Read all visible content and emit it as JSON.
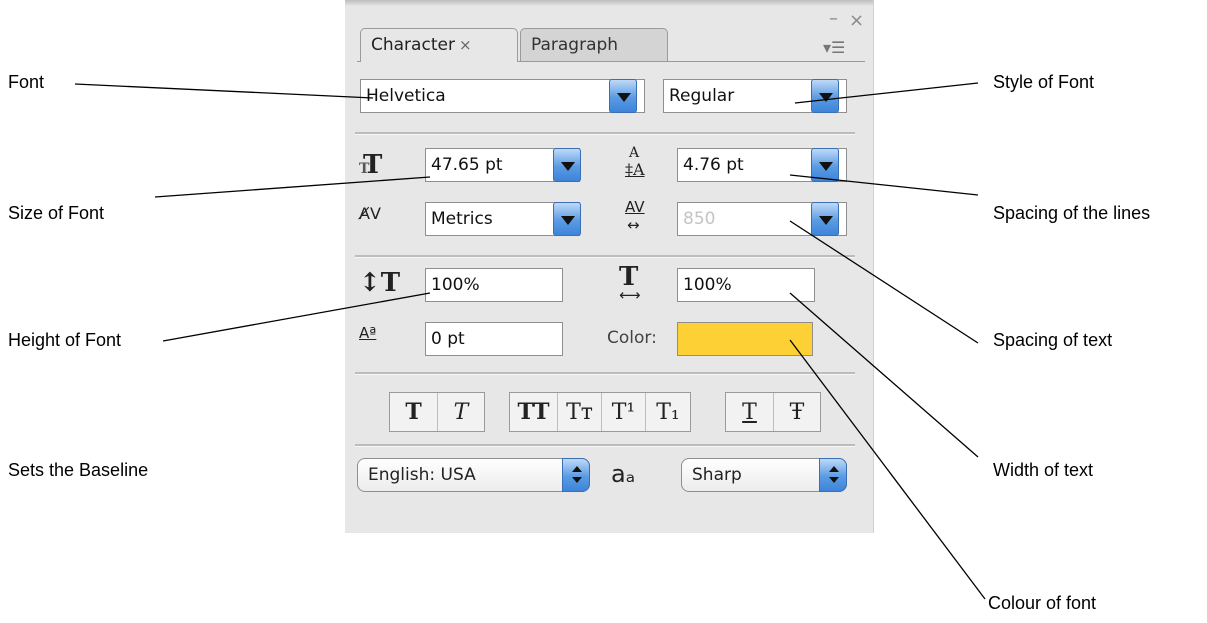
{
  "callouts": {
    "font": "Font",
    "size_of_font": "Size of Font",
    "height_of_font": "Height of Font",
    "sets_baseline": "Sets the Baseline",
    "style_of_font": "Style of Font",
    "spacing_lines": "Spacing of the lines",
    "spacing_text": "Spacing of text",
    "width_text": "Width of text",
    "colour_font": "Colour of font"
  },
  "panel": {
    "window_minimize": "–",
    "window_close": "×",
    "panel_menu_icon": "▾☰",
    "tabs": [
      {
        "label": "Character",
        "close": "×",
        "active": true
      },
      {
        "label": "Paragraph",
        "active": false
      }
    ],
    "font_family": "Helvetica",
    "font_style": "Regular",
    "font_size": "47.65 pt",
    "leading": "4.76 pt",
    "kerning": "Metrics",
    "tracking": "850",
    "vertical_scale": "100%",
    "horizontal_scale": "100%",
    "baseline_shift": "0 pt",
    "color_label": "Color:",
    "color_value": "#fdd135",
    "style_buttons_group1": [
      "T",
      "T"
    ],
    "style_buttons_group2": [
      "TT",
      "Tт",
      "T¹",
      "T₁"
    ],
    "style_buttons_group3": [
      "T",
      "Ŧ"
    ],
    "language": "English: USA",
    "antialias_icon": "aₐ",
    "antialias": "Sharp"
  }
}
